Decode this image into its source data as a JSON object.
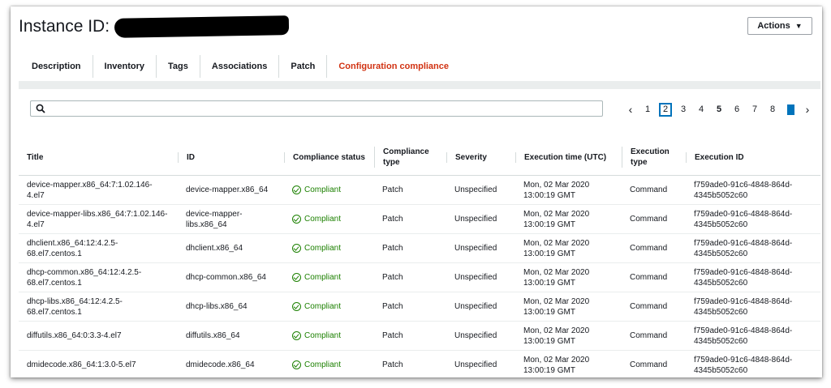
{
  "header": {
    "instance_label": "Instance ID:",
    "actions_label": "Actions",
    "tabs": [
      "Description",
      "Inventory",
      "Tags",
      "Associations",
      "Patch",
      "Configuration compliance"
    ]
  },
  "search": {
    "placeholder": ""
  },
  "pagination": {
    "pages": [
      "1",
      "2",
      "3",
      "4",
      "5",
      "6",
      "7",
      "8"
    ],
    "current": "2"
  },
  "table": {
    "columns": [
      "Title",
      "ID",
      "Compliance status",
      "Compliance type",
      "Severity",
      "Execution time (UTC)",
      "Execution type",
      "Execution ID"
    ],
    "rows": [
      {
        "title": "device-mapper.x86_64:7:1.02.146-4.el7",
        "id": "device-mapper.x86_64",
        "status": "Compliant",
        "type": "Patch",
        "severity": "Unspecified",
        "time": "Mon, 02 Mar 2020 13:00:19 GMT",
        "exec_type": "Command",
        "exec_id": "f759ade0-91c6-4848-864d-4345b5052c60"
      },
      {
        "title": "device-mapper-libs.x86_64:7:1.02.146-4.el7",
        "id": "device-mapper-libs.x86_64",
        "status": "Compliant",
        "type": "Patch",
        "severity": "Unspecified",
        "time": "Mon, 02 Mar 2020 13:00:19 GMT",
        "exec_type": "Command",
        "exec_id": "f759ade0-91c6-4848-864d-4345b5052c60"
      },
      {
        "title": "dhclient.x86_64:12:4.2.5-68.el7.centos.1",
        "id": "dhclient.x86_64",
        "status": "Compliant",
        "type": "Patch",
        "severity": "Unspecified",
        "time": "Mon, 02 Mar 2020 13:00:19 GMT",
        "exec_type": "Command",
        "exec_id": "f759ade0-91c6-4848-864d-4345b5052c60"
      },
      {
        "title": "dhcp-common.x86_64:12:4.2.5-68.el7.centos.1",
        "id": "dhcp-common.x86_64",
        "status": "Compliant",
        "type": "Patch",
        "severity": "Unspecified",
        "time": "Mon, 02 Mar 2020 13:00:19 GMT",
        "exec_type": "Command",
        "exec_id": "f759ade0-91c6-4848-864d-4345b5052c60"
      },
      {
        "title": "dhcp-libs.x86_64:12:4.2.5-68.el7.centos.1",
        "id": "dhcp-libs.x86_64",
        "status": "Compliant",
        "type": "Patch",
        "severity": "Unspecified",
        "time": "Mon, 02 Mar 2020 13:00:19 GMT",
        "exec_type": "Command",
        "exec_id": "f759ade0-91c6-4848-864d-4345b5052c60"
      },
      {
        "title": "diffutils.x86_64:0:3.3-4.el7",
        "id": "diffutils.x86_64",
        "status": "Compliant",
        "type": "Patch",
        "severity": "Unspecified",
        "time": "Mon, 02 Mar 2020 13:00:19 GMT",
        "exec_type": "Command",
        "exec_id": "f759ade0-91c6-4848-864d-4345b5052c60"
      },
      {
        "title": "dmidecode.x86_64:1:3.0-5.el7",
        "id": "dmidecode.x86_64",
        "status": "Compliant",
        "type": "Patch",
        "severity": "Unspecified",
        "time": "Mon, 02 Mar 2020 13:00:19 GMT",
        "exec_type": "Command",
        "exec_id": "f759ade0-91c6-4848-864d-4345b5052c60"
      }
    ]
  },
  "colors": {
    "active_tab": "#d13212",
    "compliant": "#1d8102",
    "link": "#0073bb"
  }
}
